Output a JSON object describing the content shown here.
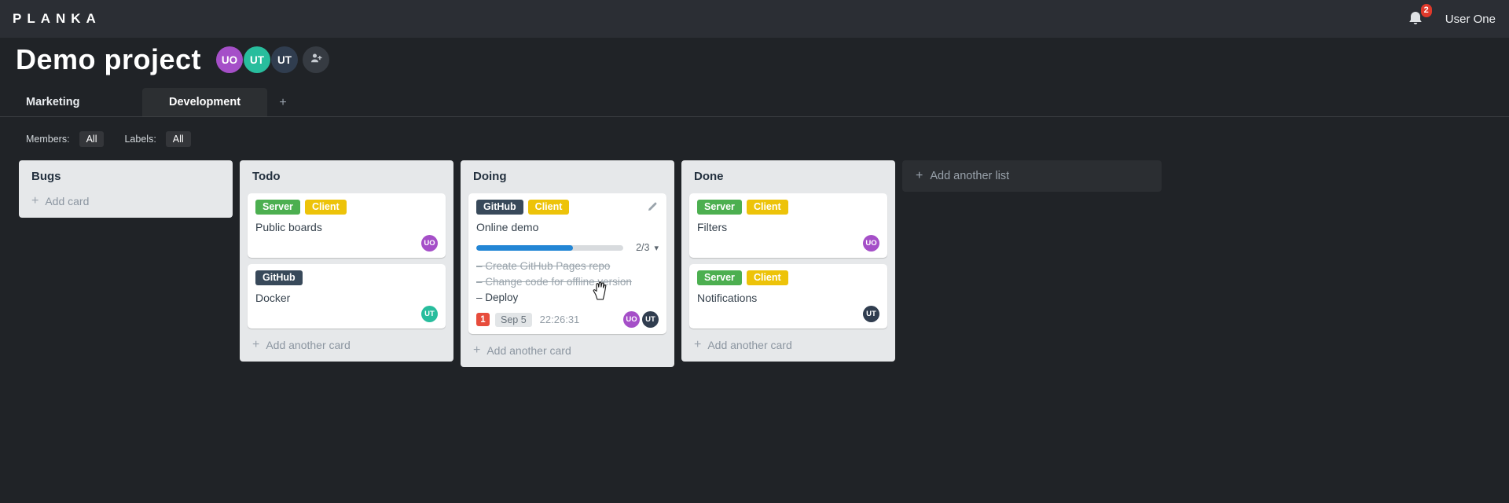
{
  "topbar": {
    "logo": "PLANKA",
    "notifications_count": "2",
    "user_name": "User One"
  },
  "header": {
    "title": "Demo project",
    "members": [
      {
        "initials": "UO",
        "color": "#a54fc8"
      },
      {
        "initials": "UT",
        "color": "#28bd9d"
      },
      {
        "initials": "UT",
        "color": "#303d4f"
      }
    ]
  },
  "tabs": {
    "items": [
      {
        "label": "Marketing",
        "active": false
      },
      {
        "label": "Development",
        "active": true
      }
    ],
    "add_label": "+"
  },
  "filters": {
    "members_label": "Members:",
    "members_value": "All",
    "labels_label": "Labels:",
    "labels_value": "All"
  },
  "board": {
    "add_list_label": "Add another list",
    "lists": [
      {
        "title": "Bugs",
        "add_label": "Add card",
        "cards": []
      },
      {
        "title": "Todo",
        "add_label": "Add another card",
        "cards": [
          {
            "title": "Public boards",
            "labels": [
              {
                "text": "Server",
                "color": "#4caf50"
              },
              {
                "text": "Client",
                "color": "#edc309"
              }
            ],
            "members": [
              {
                "initials": "UO",
                "color": "#a54fc8"
              }
            ]
          },
          {
            "title": "Docker",
            "labels": [
              {
                "text": "GitHub",
                "color": "#38495a"
              }
            ],
            "members": [
              {
                "initials": "UT",
                "color": "#28bd9d"
              }
            ]
          }
        ]
      },
      {
        "title": "Doing",
        "add_label": "Add another card",
        "cards": [
          {
            "title": "Online demo",
            "labels": [
              {
                "text": "GitHub",
                "color": "#38495a"
              },
              {
                "text": "Client",
                "color": "#edc309"
              }
            ],
            "progress": {
              "done": 2,
              "total": 3,
              "label": "2/3",
              "percent": "66%"
            },
            "tasks": [
              {
                "text": "Create GitHub Pages repo",
                "done": true
              },
              {
                "text": "Change code for offline version",
                "done": true
              },
              {
                "text": "Deploy",
                "done": false
              }
            ],
            "notification_count": "1",
            "due_date": "Sep 5",
            "timer": "22:26:31",
            "members": [
              {
                "initials": "UO",
                "color": "#a54fc8"
              },
              {
                "initials": "UT",
                "color": "#303d4f"
              }
            ]
          }
        ]
      },
      {
        "title": "Done",
        "add_label": "Add another card",
        "cards": [
          {
            "title": "Filters",
            "labels": [
              {
                "text": "Server",
                "color": "#4caf50"
              },
              {
                "text": "Client",
                "color": "#edc309"
              }
            ],
            "members": [
              {
                "initials": "UO",
                "color": "#a54fc8"
              }
            ]
          },
          {
            "title": "Notifications",
            "labels": [
              {
                "text": "Server",
                "color": "#4caf50"
              },
              {
                "text": "Client",
                "color": "#edc309"
              }
            ],
            "members": [
              {
                "initials": "UT",
                "color": "#303d4f"
              }
            ]
          }
        ]
      }
    ]
  }
}
